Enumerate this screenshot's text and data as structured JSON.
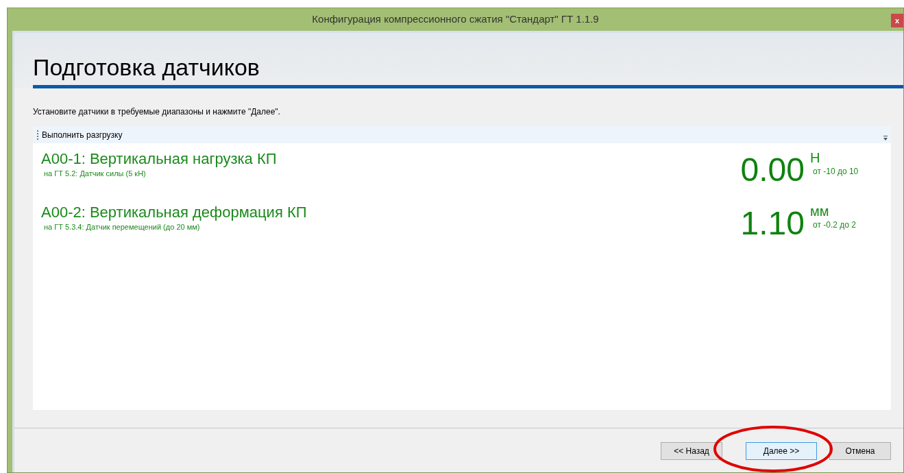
{
  "window": {
    "title": "Конфигурация компрессионного сжатия \"Стандарт\" ГТ 1.1.9",
    "close": "x"
  },
  "heading": "Подготовка датчиков",
  "instruction": "Установите датчики в требуемые диапазоны и нажмите \"Далее\".",
  "toolbar": {
    "action": "Выполнить разгрузку"
  },
  "sensors": [
    {
      "name": "A00-1: Вертикальная нагрузка КП",
      "source": "на ГТ 5.2: Датчик силы (5 кН)",
      "value": "0.00",
      "unit": "Н",
      "range": "от -10 до 10"
    },
    {
      "name": "A00-2: Вертикальная деформация КП",
      "source": "на ГТ 5.3.4: Датчик перемещений (до 20 мм)",
      "value": "1.10",
      "unit": "мм",
      "range": "от -0.2 до 2"
    }
  ],
  "buttons": [
    {
      "label": "<< Назад",
      "focused": false
    },
    {
      "label": "Далее >>",
      "focused": true
    },
    {
      "label": "Отмена",
      "focused": false
    }
  ]
}
